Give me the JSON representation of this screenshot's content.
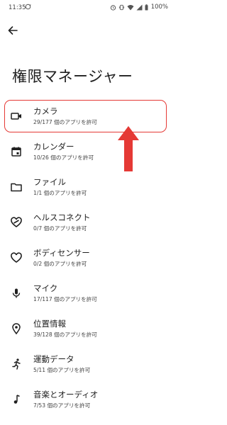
{
  "status_bar": {
    "time": "11:35",
    "battery": "100%"
  },
  "header": {
    "title": "権限マネージャー"
  },
  "items": [
    {
      "label": "カメラ",
      "sub": "29/177 個のアプリを許可"
    },
    {
      "label": "カレンダー",
      "sub": "10/26 個のアプリを許可"
    },
    {
      "label": "ファイル",
      "sub": "1/1 個のアプリを許可"
    },
    {
      "label": "ヘルスコネクト",
      "sub": "0/7 個のアプリを許可"
    },
    {
      "label": "ボディセンサー",
      "sub": "0/2 個のアプリを許可"
    },
    {
      "label": "マイク",
      "sub": "17/117 個のアプリを許可"
    },
    {
      "label": "位置情報",
      "sub": "39/128 個のアプリを許可"
    },
    {
      "label": "運動データ",
      "sub": "5/11 個のアプリを許可"
    },
    {
      "label": "音楽とオーディオ",
      "sub": "7/53 個のアプリを許可"
    }
  ],
  "colors": {
    "highlight": "#e53935",
    "text": "#1f1f1f",
    "subtext": "#444444"
  },
  "icons": [
    "camera-icon",
    "calendar-icon",
    "folder-icon",
    "health-connect-icon",
    "heart-icon",
    "microphone-icon",
    "location-icon",
    "running-icon",
    "music-note-icon"
  ]
}
